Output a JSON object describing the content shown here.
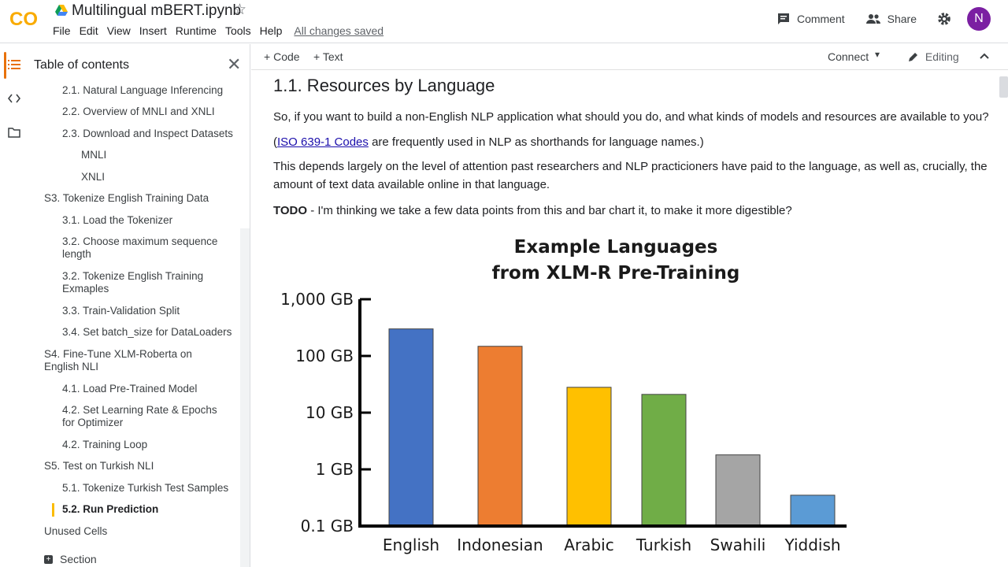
{
  "header": {
    "title": "Multilingual mBERT.ipynb",
    "menu": [
      "File",
      "Edit",
      "View",
      "Insert",
      "Runtime",
      "Tools",
      "Help"
    ],
    "saved_status": "All changes saved",
    "comment_label": "Comment",
    "share_label": "Share",
    "avatar_initial": "N",
    "logo_text": "CO"
  },
  "toc": {
    "title": "Table of contents",
    "items": [
      {
        "label": "2.1. Natural Language Inferencing"
      },
      {
        "label": "2.2. Overview of MNLI and XNLI"
      },
      {
        "label": "2.3. Download and Inspect Datasets"
      },
      {
        "label": "MNLI"
      },
      {
        "label": "XNLI"
      },
      {
        "label": "S3. Tokenize English Training Data"
      },
      {
        "label": "3.1. Load the Tokenizer"
      },
      {
        "label": "3.2. Choose maximum sequence length"
      },
      {
        "label": "3.2. Tokenize English Training Exmaples"
      },
      {
        "label": "3.3. Train-Validation Split"
      },
      {
        "label": "3.4. Set batch_size for DataLoaders"
      },
      {
        "label": "S4. Fine-Tune XLM-Roberta on English NLI"
      },
      {
        "label": "4.1. Load Pre-Trained Model"
      },
      {
        "label": "4.2. Set Learning Rate & Epochs for Optimizer"
      },
      {
        "label": "4.2. Training Loop"
      },
      {
        "label": "S5. Test on Turkish NLI"
      },
      {
        "label": "5.1. Tokenize Turkish Test Samples"
      },
      {
        "label": "5.2. Run Prediction"
      },
      {
        "label": "Unused Cells"
      }
    ],
    "section_label": "Section"
  },
  "toolbar": {
    "code_label": "Code",
    "text_label": "Text",
    "connect_label": "Connect",
    "editing_label": "Editing"
  },
  "content": {
    "heading": "1.1. Resources by Language",
    "p1": "So, if you want to build a non-English NLP application what should you do, and what kinds of models and resources are available to you?",
    "p2_open": "(",
    "p2_link": "ISO 639-1 Codes",
    "p2_rest": " are frequently used in NLP as shorthands for language names.)",
    "p3": "This depends largely on the level of attention past researchers and NLP practicioners have paid to the language, as well as, crucially, the amount of text data available online in that language.",
    "p4_bold": "TODO",
    "p4_rest": " - I'm thinking we take a few data points from this and bar chart it, to make it more digestible?"
  },
  "chart_data": {
    "type": "bar",
    "title_line1": "Example Languages",
    "title_line2": "from XLM-R Pre-Training",
    "categories": [
      "English",
      "Indonesian",
      "Arabic",
      "Turkish",
      "Swahili",
      "Yiddish"
    ],
    "values": [
      300,
      148,
      28,
      21,
      1.8,
      0.35
    ],
    "colors": [
      "#4472c4",
      "#ed7d31",
      "#ffc000",
      "#70ad47",
      "#a5a5a5",
      "#5b9bd5"
    ],
    "y_scale": "log",
    "ylim": [
      0.1,
      1000
    ],
    "ytick_values": [
      0.1,
      1,
      10,
      100,
      1000
    ],
    "ytick_labels": [
      "0.1 GB",
      "1 GB",
      "10 GB",
      "100 GB",
      "1,000 GB"
    ],
    "grid": false
  }
}
